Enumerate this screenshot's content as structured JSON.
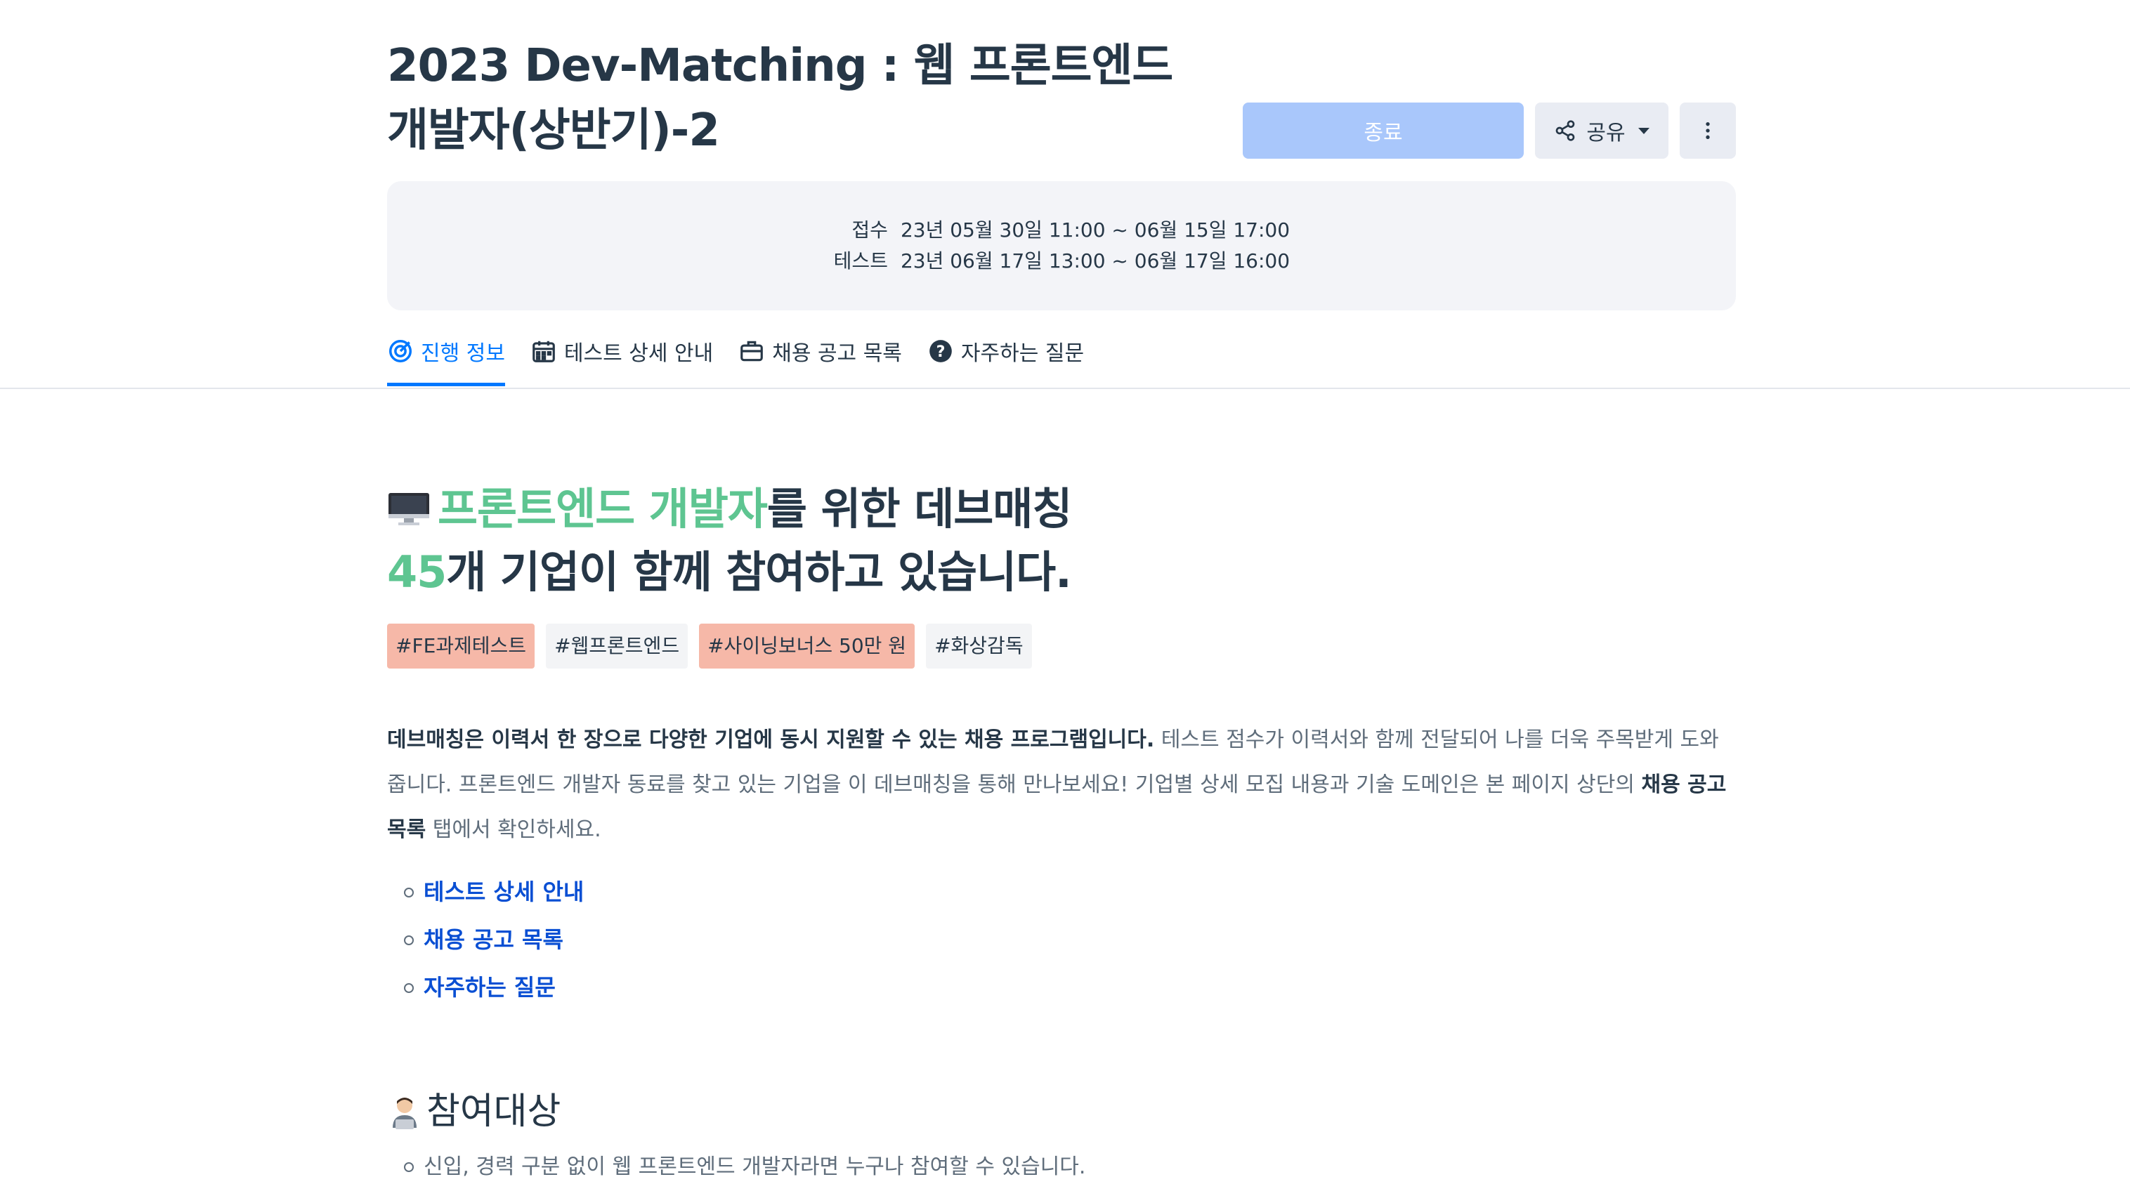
{
  "header": {
    "title_line1": "2023 Dev-Matching : 웹 프론트엔드",
    "title_line2": "개발자(상반기)-2",
    "end_button": "종료",
    "share_button": "공유"
  },
  "schedule": {
    "apply_label": "접수",
    "apply_value": "23년 05월 30일 11:00 ~ 06월 15일 17:00",
    "test_label": "테스트",
    "test_value": "23년 06월 17일 13:00 ~ 06월 17일 16:00"
  },
  "tabs": [
    {
      "label": "진행 정보",
      "icon": "target-icon"
    },
    {
      "label": "테스트 상세 안내",
      "icon": "calendar-icon"
    },
    {
      "label": "채용 공고 목록",
      "icon": "briefcase-icon"
    },
    {
      "label": "자주하는 질문",
      "icon": "question-icon"
    }
  ],
  "headline": {
    "part1": "프론트엔드 개발자",
    "part2": "를 위한 데브매칭",
    "count": "45",
    "part3": "개 기업이 함께 참여하고 있습니다."
  },
  "tags": [
    "#FE과제테스트",
    "#웹프론트엔드",
    "#사이닝보너스 50만 원",
    "#화상감독"
  ],
  "intro": {
    "bold1": "데브매칭은 이력서 한 장으로 다양한 기업에 동시 지원할 수 있는 채용 프로그램입니다.",
    "text1": " 테스트 점수가 이력서와 함께 전달되어 나를 더욱 주목받게 도와줍니다. 프론트엔드 개발자 동료를 찾고 있는 기업을 이 데브매칭을 통해 만나보세요! 기업별 상세 모집 내용과 기술 도메인은 본 페이지 상단의 ",
    "bold2": "채용 공고 목록",
    "text2": " 탭에서 확인하세요."
  },
  "links": [
    "테스트 상세 안내",
    "채용 공고 목록",
    "자주하는 질문"
  ],
  "participants": {
    "heading": "참여대상",
    "items": [
      "신입, 경력 구분 없이 웹 프론트엔드 개발자라면 누구나 참여할 수 있습니다."
    ]
  },
  "colors": {
    "primary": "#0078ff",
    "green": "#5ec591",
    "end_button_bg": "#a9c7fb",
    "tag_highlight": "#f6b8a8",
    "link": "#0a4fd3"
  }
}
